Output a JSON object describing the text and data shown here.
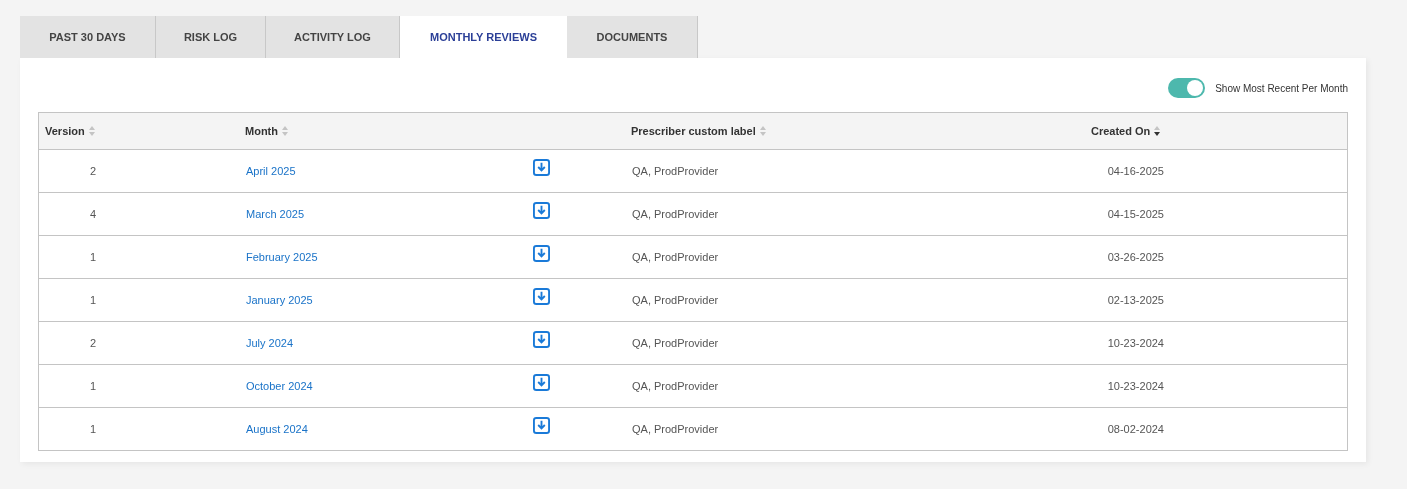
{
  "tabs": [
    {
      "label": "PAST 30 DAYS",
      "selected": false
    },
    {
      "label": "RISK LOG",
      "selected": false
    },
    {
      "label": "ACTIVITY LOG",
      "selected": false
    },
    {
      "label": "MONTHLY REVIEWS",
      "selected": true
    },
    {
      "label": "DOCUMENTS",
      "selected": false
    }
  ],
  "toggle": {
    "label": "Show Most Recent Per Month",
    "on": true
  },
  "table": {
    "columns": [
      {
        "label": "Version",
        "sorted_descending": false
      },
      {
        "label": "Month",
        "sorted_descending": false
      },
      {
        "label": "Prescriber custom label",
        "sorted_descending": false
      },
      {
        "label": "Created On",
        "sorted_descending": true
      }
    ],
    "rows": [
      {
        "version": "2",
        "month": "April 2025",
        "prescriber": "QA, ProdProvider",
        "created": "04-16-2025"
      },
      {
        "version": "4",
        "month": "March 2025",
        "prescriber": "QA, ProdProvider",
        "created": "04-15-2025"
      },
      {
        "version": "1",
        "month": "February 2025",
        "prescriber": "QA, ProdProvider",
        "created": "03-26-2025"
      },
      {
        "version": "1",
        "month": "January 2025",
        "prescriber": "QA, ProdProvider",
        "created": "02-13-2025"
      },
      {
        "version": "2",
        "month": "July 2024",
        "prescriber": "QA, ProdProvider",
        "created": "10-23-2024"
      },
      {
        "version": "1",
        "month": "October 2024",
        "prescriber": "QA, ProdProvider",
        "created": "10-23-2024"
      },
      {
        "version": "1",
        "month": "August 2024",
        "prescriber": "QA, ProdProvider",
        "created": "08-02-2024"
      }
    ]
  }
}
